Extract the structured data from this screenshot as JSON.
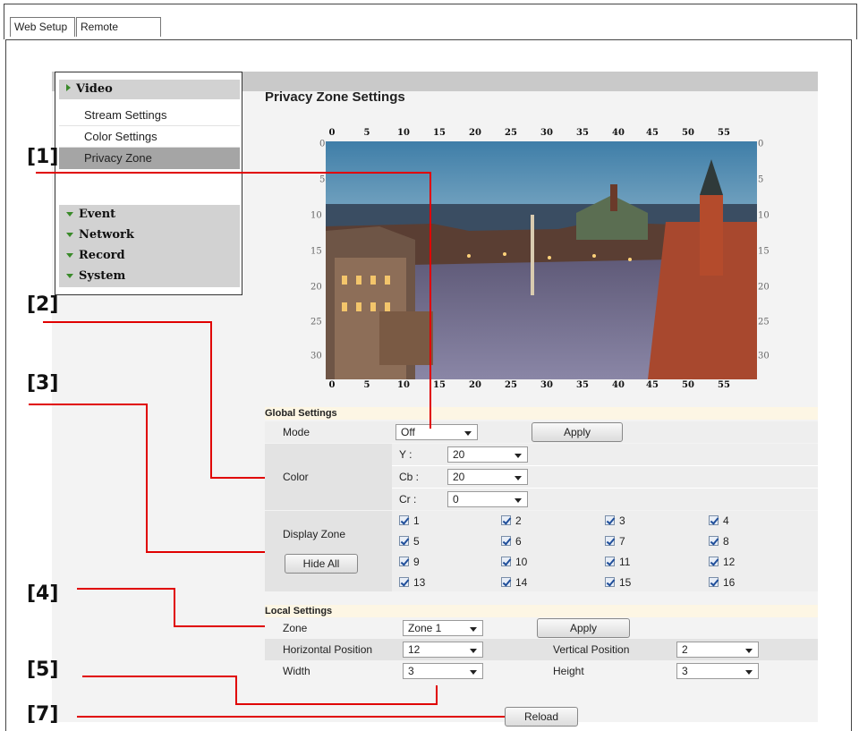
{
  "tabs": [
    "Web Setup",
    "Remote Backup"
  ],
  "menu": {
    "video_label": "Video",
    "video_items": [
      "Stream Settings",
      "Color Settings",
      "Privacy Zone"
    ],
    "sections": [
      "Event",
      "Network",
      "Record",
      "System"
    ]
  },
  "page_title": "Privacy Zone Settings",
  "grid": {
    "x_ticks": [
      "0",
      "5",
      "10",
      "15",
      "20",
      "25",
      "30",
      "35",
      "40",
      "45",
      "50",
      "55"
    ],
    "y_ticks": [
      "0",
      "5",
      "10",
      "15",
      "20",
      "25",
      "30"
    ]
  },
  "global": {
    "header": "Global Settings",
    "mode_label": "Mode",
    "mode_value": "Off",
    "apply_label": "Apply",
    "color_label": "Color",
    "y_label": "Y :",
    "y_value": "20",
    "cb_label": "Cb :",
    "cb_value": "20",
    "cr_label": "Cr :",
    "cr_value": "0",
    "display_zone_label": "Display Zone",
    "hide_all_label": "Hide All",
    "zones": [
      "1",
      "2",
      "3",
      "4",
      "5",
      "6",
      "7",
      "8",
      "9",
      "10",
      "11",
      "12",
      "13",
      "14",
      "15",
      "16"
    ]
  },
  "local": {
    "header": "Local Settings",
    "zone_label": "Zone",
    "zone_value": "Zone 1",
    "apply_label": "Apply",
    "hpos_label": "Horizontal Position",
    "hpos_value": "12",
    "vpos_label": "Vertical Position",
    "vpos_value": "2",
    "width_label": "Width",
    "width_value": "3",
    "height_label": "Height",
    "height_value": "3"
  },
  "reload_label": "Reload",
  "callouts": [
    "[1]",
    "[2]",
    "[3]",
    "[4]",
    "[5]",
    "[7]"
  ],
  "colors": {
    "callout_line": "#e00000",
    "menu_arrow": "#3a8a2a"
  }
}
